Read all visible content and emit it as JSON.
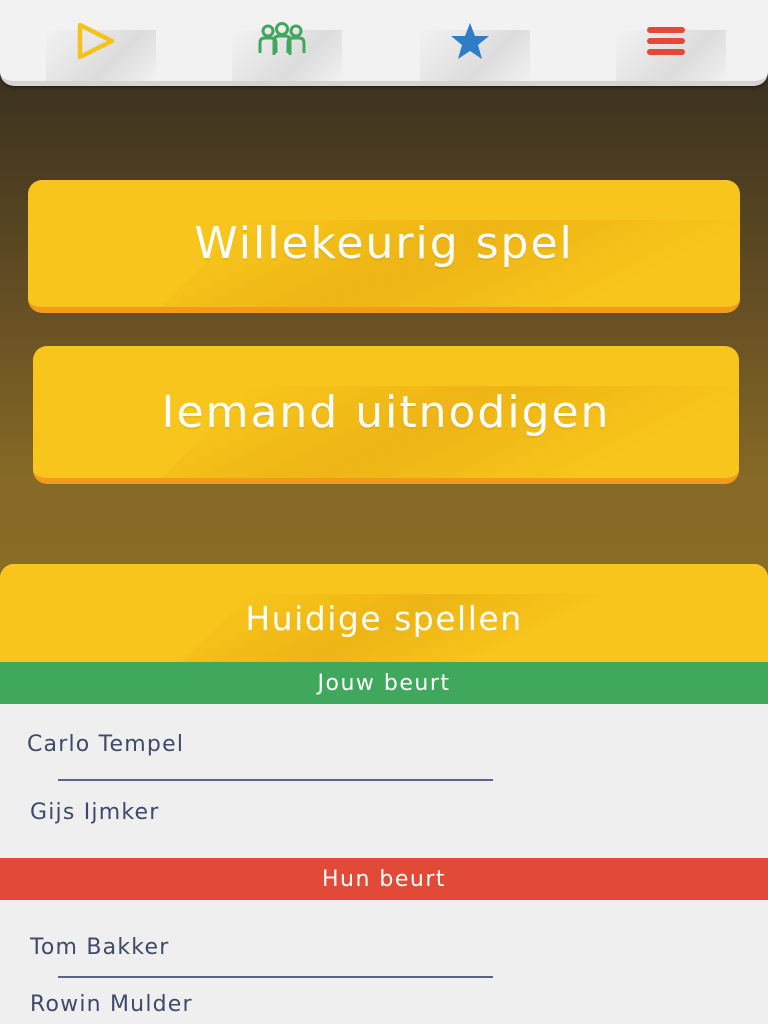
{
  "nav": {
    "items": [
      {
        "name": "play",
        "icon": "play-icon",
        "color": "#f5c21b"
      },
      {
        "name": "friends",
        "icon": "group-icon",
        "color": "#3fa85c"
      },
      {
        "name": "favorites",
        "icon": "star-icon",
        "color": "#2e7dc6"
      },
      {
        "name": "menu",
        "icon": "menu-icon",
        "color": "#e24a37"
      }
    ]
  },
  "actions": {
    "random_game": "Willekeurig spel",
    "invite": "Iemand uitnodigen"
  },
  "games": {
    "title": "Huidige spellen",
    "your_turn": {
      "label": "Jouw beurt",
      "players": [
        "Carlo Tempel",
        "Gijs Ijmker"
      ]
    },
    "their_turn": {
      "label": "Hun beurt",
      "players": [
        "Tom Bakker",
        "Rowin Mulder"
      ]
    }
  },
  "colors": {
    "yellow": "#f7c51b",
    "orange_edge": "#f29a1c",
    "green": "#3fa85c",
    "red": "#e24a37",
    "text_dark": "#3d4a6b"
  }
}
